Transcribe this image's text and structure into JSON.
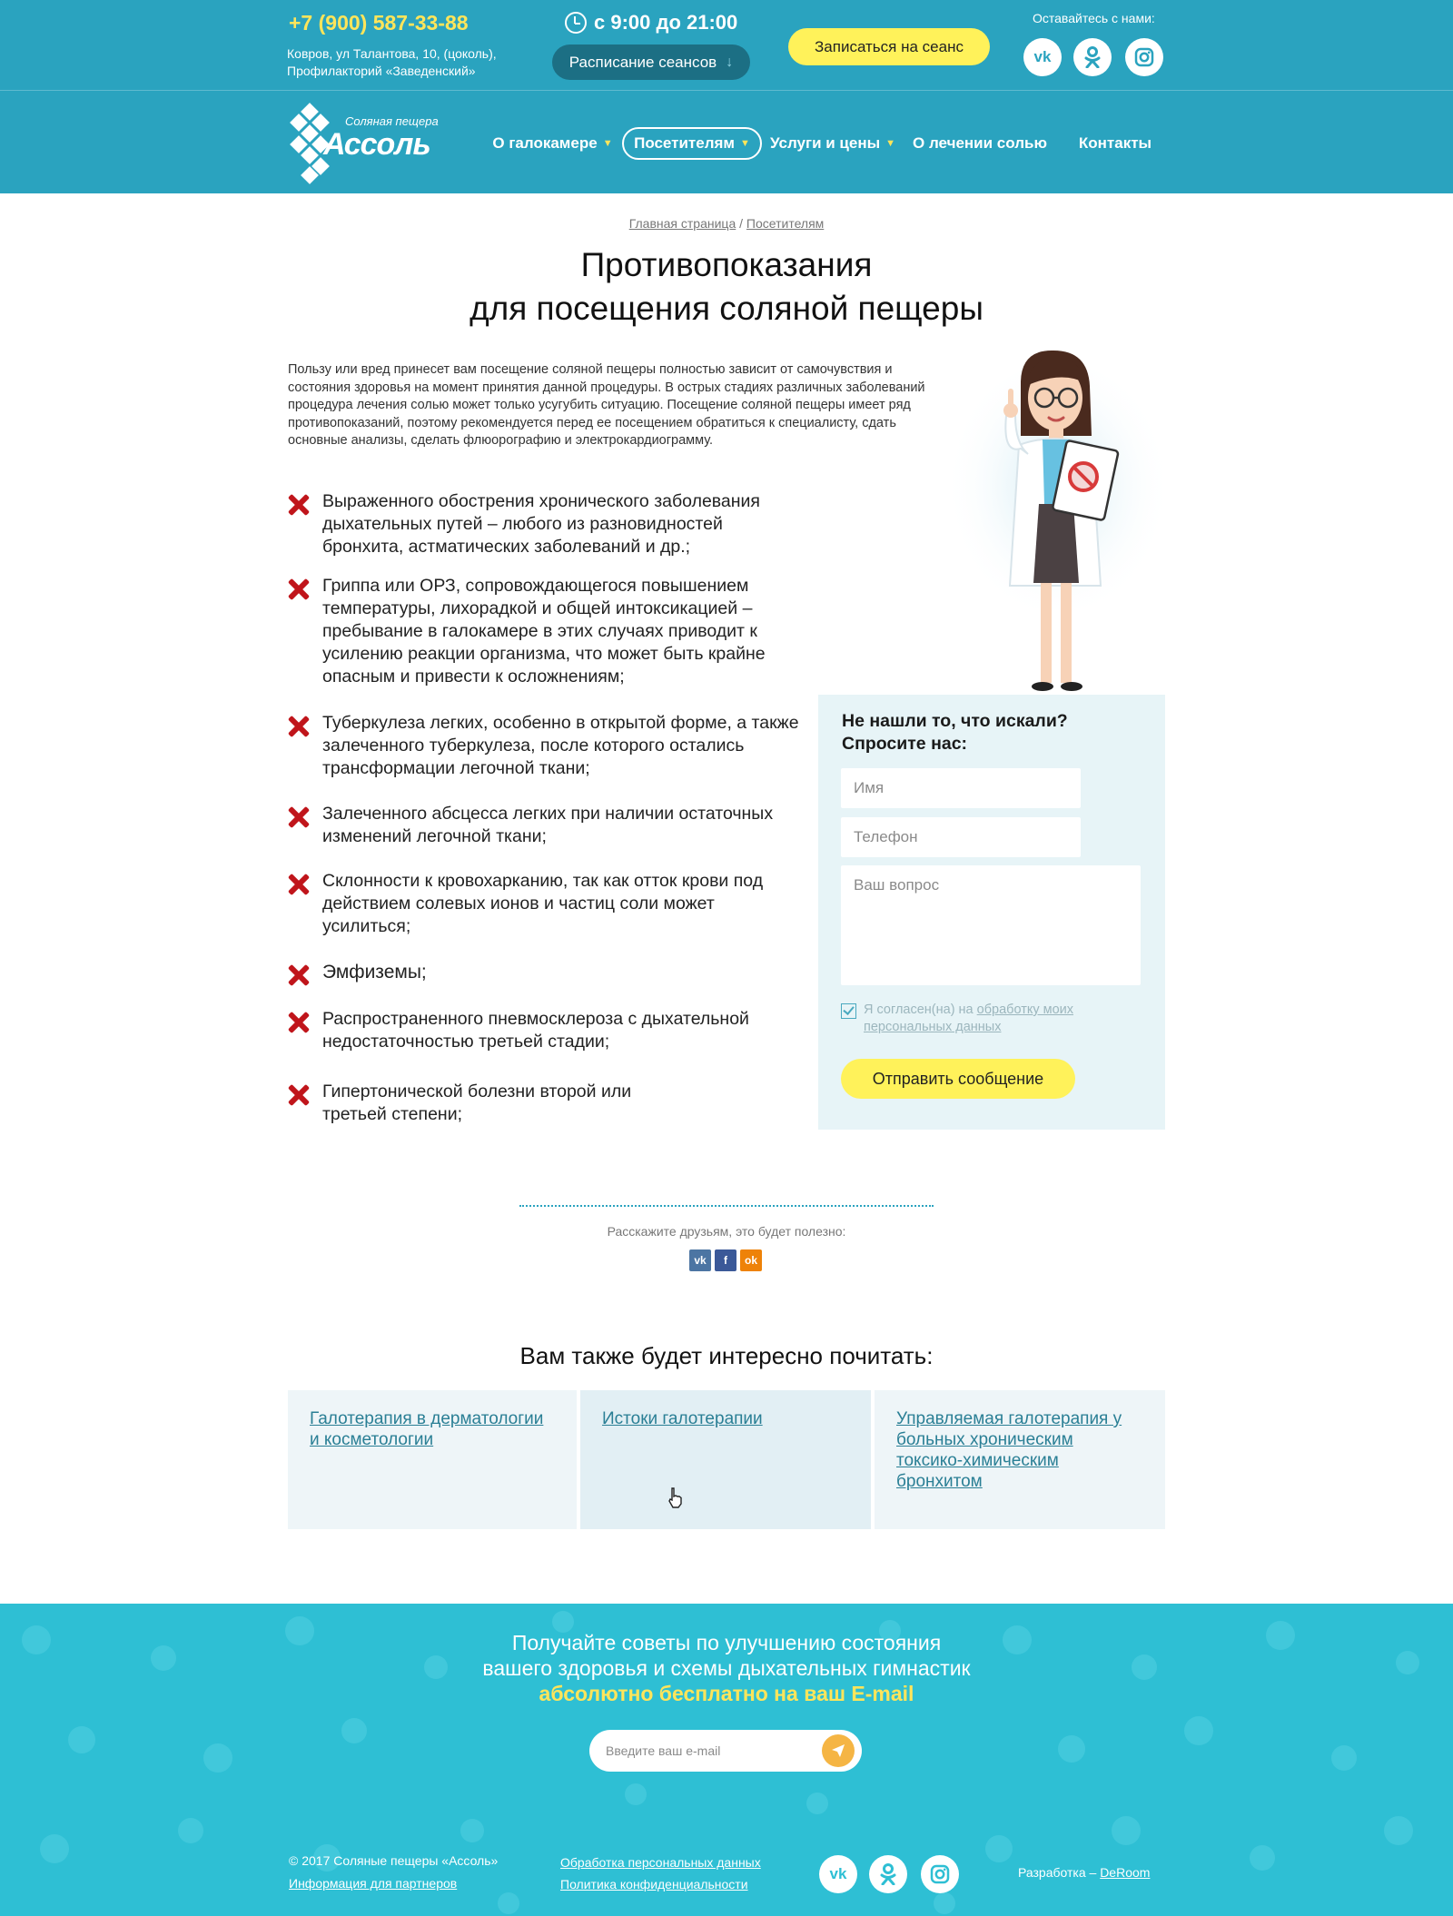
{
  "header": {
    "phone": "+7 (900) 587-33-88",
    "address": "Ковров, ул Талантова, 10, (цоколь), Профилакторий «Заведенский»",
    "hours": "с 9:00 до 21:00",
    "schedule_label": "Расписание сеансов",
    "signup_label": "Записаться на сеанс",
    "follow_label": "Оставайтесь с нами:",
    "social": [
      "vk-icon",
      "odnoklassniki-icon",
      "instagram-icon"
    ]
  },
  "logo": {
    "subtitle": "Соляная пещера",
    "name": "Ассоль"
  },
  "nav": {
    "items": [
      {
        "label": "О галокамере",
        "has_dropdown": true
      },
      {
        "label": "Посетителям",
        "has_dropdown": true,
        "active": true
      },
      {
        "label": "Услуги и цены",
        "has_dropdown": true
      },
      {
        "label": "О лечении солью",
        "has_dropdown": false
      },
      {
        "label": "Контакты",
        "has_dropdown": false
      }
    ]
  },
  "breadcrumb": {
    "home": "Главная страница",
    "separator": " / ",
    "current": "Посетителям"
  },
  "page": {
    "title_line1": "Противопоказания",
    "title_line2": "для посещения соляной пещеры",
    "intro": "Пользу или вред принесет вам посещение соляной пещеры полностью зависит от самочувствия и состояния здоровья на момент принятия данной процедуры. В острых стадиях различных заболеваний процедура лечения солью может только усугубить ситуацию. Посещение соляной пещеры имеет ряд противопоказаний, поэтому рекомендуется перед ее посещением обратиться к специалисту, сдать основные анализы, сделать флюорографию и электрокардиограмму."
  },
  "contraindications": [
    "Выраженного обострения хронического заболевания дыхательных путей – любого из разновидностей бронхита, астматических заболеваний и др.;",
    "Гриппа или ОРЗ, сопровождающегося повышением температуры, лихорадкой и общей интоксикацией – пребывание в галокамере в этих случаях приводит к усилению реакции организма, что может быть крайне опасным и привести к осложнениям;",
    "Туберкулеза легких, особенно в открытой форме, а также залеченного туберкулеза, после которого остались трансформации легочной ткани;",
    "Залеченного абсцесса легких при наличии остаточных изменений легочной ткани;",
    "Склонности к кровохарканию, так как отток крови под действием солевых ионов и частиц соли может усилиться;",
    "Эмфиземы;",
    "Распространенного пневмосклероза с дыхательной недостаточностью третьей стадии;",
    "Гипертонической болезни второй или третьей степени;"
  ],
  "form": {
    "title": "Не нашли то, что искали? Спросите нас:",
    "name_placeholder": "Имя",
    "phone_placeholder": "Телефон",
    "question_placeholder": "Ваш вопрос",
    "consent_prefix": "Я согласен(на) на ",
    "consent_link": "обработку моих персональных данных",
    "consent_checked": true,
    "submit_label": "Отправить сообщение"
  },
  "share": {
    "label": "Расскажите друзьям, это будет полезно:",
    "buttons": [
      {
        "icon": "vk-icon",
        "text": "vk",
        "color": "#4c75a3"
      },
      {
        "icon": "facebook-icon",
        "text": "f",
        "color": "#3b5998"
      },
      {
        "icon": "odnoklassniki-icon",
        "text": "ok",
        "color": "#ee8208"
      }
    ]
  },
  "related": {
    "title": "Вам также будет интересно почитать:",
    "cards": [
      "Галотерапия в дерматологии и косметологии",
      "Истоки галотерапии",
      "Управляемая галотерапия у больных хроническим токсико-химическим бронхитом"
    ]
  },
  "subscribe": {
    "line1": "Получайте советы по улучшению состояния",
    "line2": "вашего здоровья и схемы дыхательных гимнастик",
    "accent": "абсолютно бесплатно на ваш E-mail",
    "email_placeholder": "Введите ваш e-mail"
  },
  "footer": {
    "copyright": "© 2017 Соляные пещеры «Ассоль»",
    "partners": "Информация для партнеров",
    "personal_data": "Обработка персональных данных",
    "privacy": "Политика конфиденциальности",
    "dev_prefix": "Разработка – ",
    "dev_link": "DeRoom"
  },
  "colors": {
    "header_bg": "#2aa3bf",
    "accent_yellow": "#fff25a",
    "phone_yellow": "#ffe55a",
    "cross_red": "#c0151b",
    "subscribe_bg": "#2ebfd4",
    "link": "#2a7f95"
  }
}
